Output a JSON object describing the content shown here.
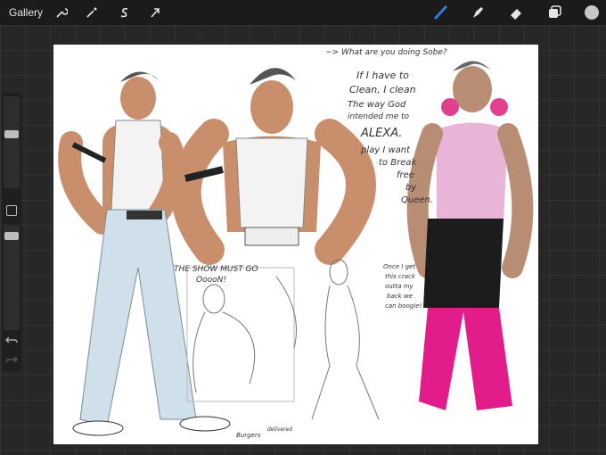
{
  "app": {
    "gallery_label": "Gallery"
  },
  "toolbar": {
    "left_tools": [
      "wrench-icon",
      "magic-wand-icon",
      "selection-s-icon",
      "transform-arrow-icon"
    ],
    "right_tools": [
      "brush-icon",
      "smudge-icon",
      "eraser-icon",
      "layers-icon",
      "color-swatch"
    ],
    "accent_color": "#2f7dd3",
    "color_swatch": "#c8c8c8"
  },
  "canvas": {
    "notes": {
      "top_question": "~> What are you doing Sobe?",
      "line1": "If I have to",
      "line2": "Clean, I clean",
      "line3": "The way God",
      "line4": "intended me to",
      "line5": "ALEXA.",
      "line6": "play I want",
      "line7": "to Break",
      "line8": "free",
      "line9": "by",
      "line10": "Queen.",
      "show": "THE SHOW MUST GO",
      "show2": "OoooN!",
      "once1": "Once I get",
      "once2": "this crack",
      "once3": "outta my",
      "once4": "back we",
      "once5": "can boogie!",
      "burgers": "Burgers",
      "burgers2": "delivered"
    }
  }
}
